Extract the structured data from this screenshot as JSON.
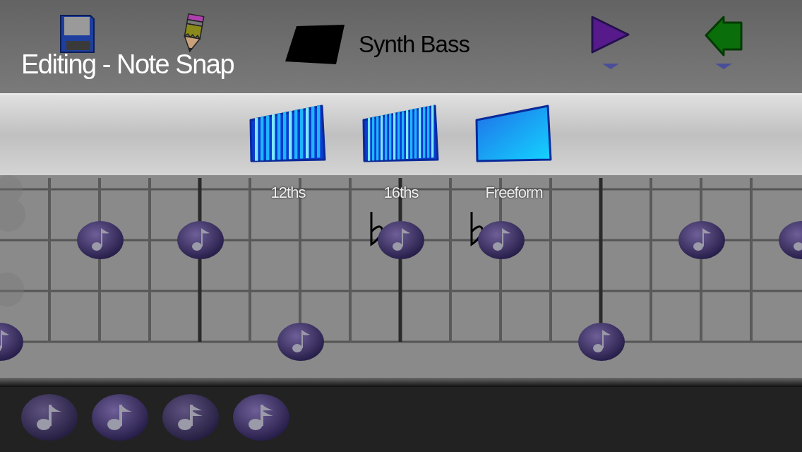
{
  "header": {
    "title": "Editing - Note Snap",
    "instrument": "Synth Bass"
  },
  "snap_options": [
    {
      "label": "12ths",
      "kind": "bars12"
    },
    {
      "label": "16ths",
      "kind": "bars16"
    },
    {
      "label": "Freeform",
      "kind": "free"
    }
  ],
  "note_palette": [
    {
      "kind": "eighth"
    },
    {
      "kind": "eighth"
    },
    {
      "kind": "sixteenth"
    },
    {
      "kind": "sixteenth"
    }
  ]
}
